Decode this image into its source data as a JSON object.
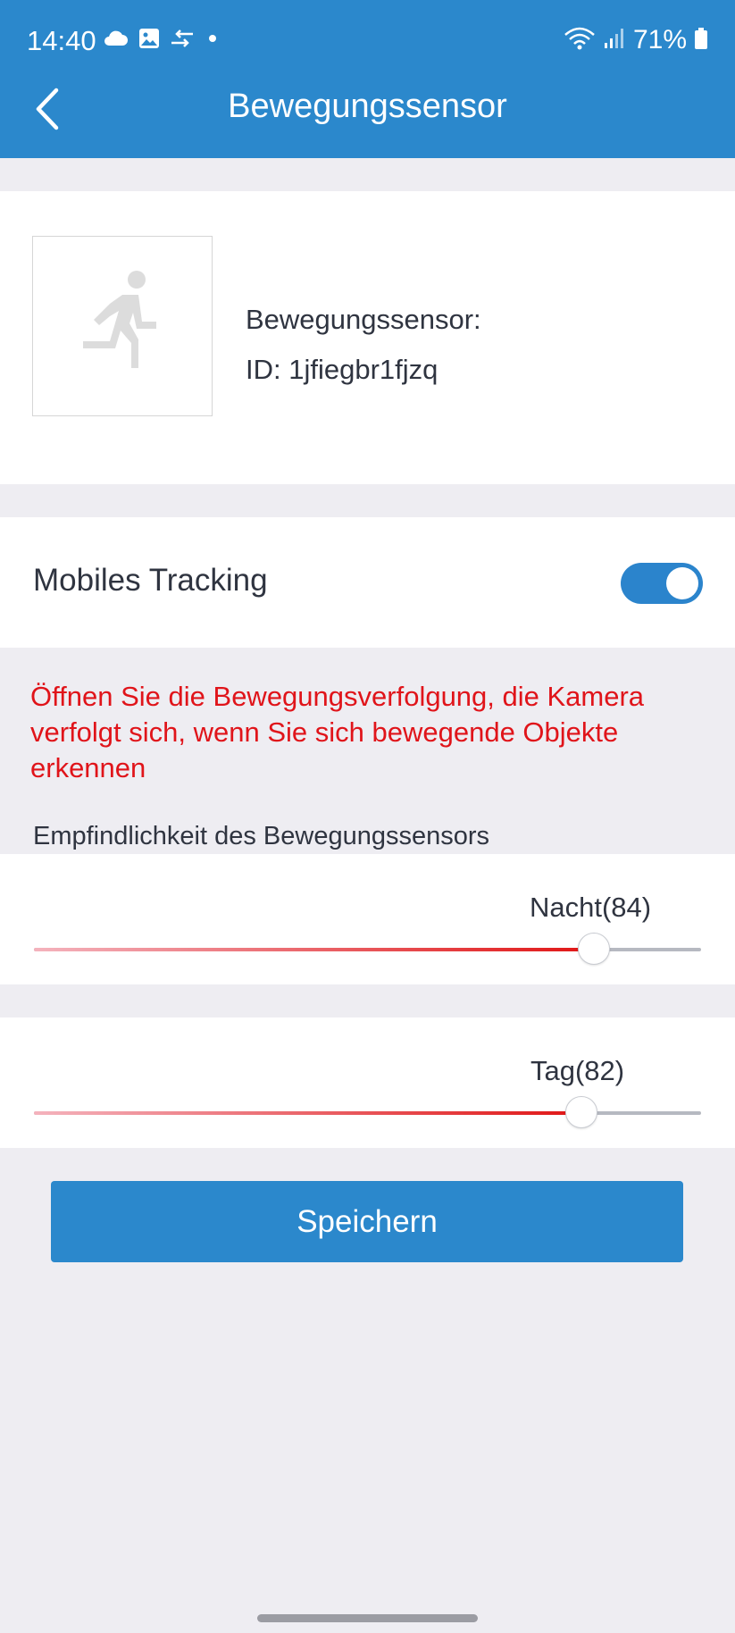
{
  "status_bar": {
    "time": "14:40",
    "battery": "71%",
    "icons": [
      "cloud-icon",
      "gallery-icon",
      "sync-arrows-icon",
      "dot-icon",
      "wifi-icon",
      "signal-icon",
      "battery-icon"
    ]
  },
  "header": {
    "title": "Bewegungssensor",
    "back_icon": "chevron-left-icon"
  },
  "device": {
    "name": "Bewegungssensor:",
    "id": "ID: 1jfiegbr1fjzq",
    "icon": "running-person-icon"
  },
  "tracking": {
    "label": "Mobiles Tracking",
    "enabled": true
  },
  "warning_text": "Öffnen Sie die Bewegungsverfolgung, die Kamera verfolgt sich, wenn Sie sich bewegende Objekte erkennen",
  "sensitivity": {
    "label": "Empfindlichkeit des Bewegungssensors",
    "night": {
      "label": "Nacht(84)",
      "value": 84,
      "max": 100
    },
    "day": {
      "label": "Tag(82)",
      "value": 82,
      "max": 100
    }
  },
  "actions": {
    "save_label": "Speichern"
  },
  "colors": {
    "header": "#2b88cc",
    "accent": "#2b84cc",
    "warning": "#e0141a",
    "slider_fill_start": "#f4b3bd",
    "slider_fill_end": "#e01515",
    "background": "#eeedf2"
  }
}
